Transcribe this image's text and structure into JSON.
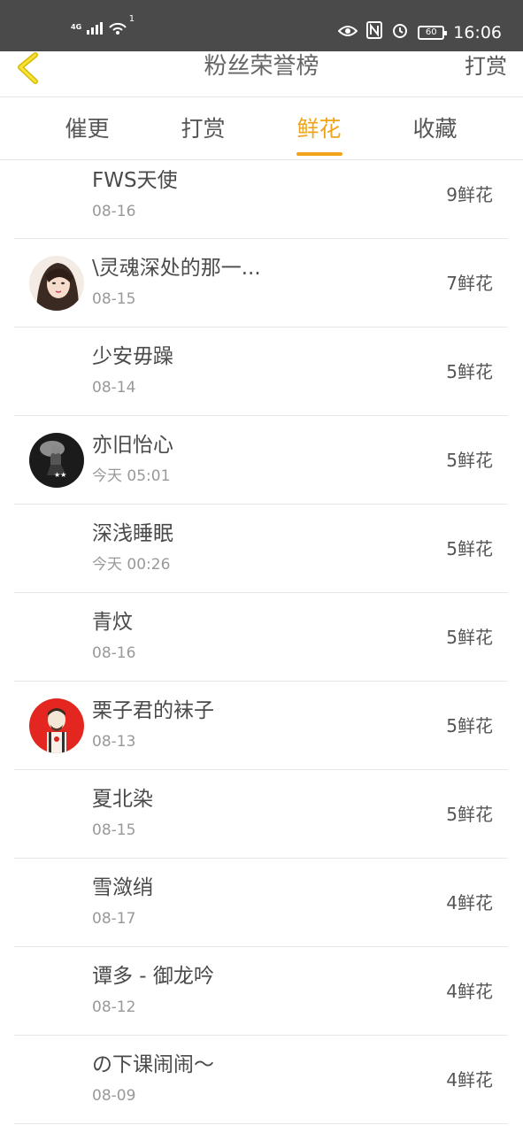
{
  "status_bar": {
    "network": "4G",
    "wifi_badge": "1",
    "battery": "60",
    "time": "16:06",
    "icons": [
      "eye-icon",
      "nfc-icon",
      "alarm-icon"
    ]
  },
  "header": {
    "title": "粉丝荣誉榜",
    "right_action": "打赏",
    "back_icon": "chevron-left-icon",
    "accent_color": "#f0a41c"
  },
  "tabs": [
    {
      "label": "催更"
    },
    {
      "label": "打赏"
    },
    {
      "label": "鲜花"
    },
    {
      "label": "收藏"
    }
  ],
  "active_tab": "鲜花",
  "list": [
    {
      "name": "FWS天使",
      "date": "08-16",
      "count": "9鲜花",
      "avatar": ""
    },
    {
      "name": "\\灵魂深处的那一...",
      "date": "08-15",
      "count": "7鲜花",
      "avatar": "girl-photo-avatar"
    },
    {
      "name": "少安毋躁",
      "date": "08-14",
      "count": "5鲜花",
      "avatar": ""
    },
    {
      "name": "亦旧怡心",
      "date": "今天 05:01",
      "count": "5鲜花",
      "avatar": "dark-photo-avatar"
    },
    {
      "name": "深浅睡眠",
      "date": "今天 00:26",
      "count": "5鲜花",
      "avatar": ""
    },
    {
      "name": "青炆",
      "date": "08-16",
      "count": "5鲜花",
      "avatar": ""
    },
    {
      "name": "栗子君的袜子",
      "date": "08-13",
      "count": "5鲜花",
      "avatar": "red-cartoon-avatar"
    },
    {
      "name": "夏北染",
      "date": "08-15",
      "count": "5鲜花",
      "avatar": ""
    },
    {
      "name": "雪潋绡",
      "date": "08-17",
      "count": "4鲜花",
      "avatar": ""
    },
    {
      "name": "谭多 - 御龙吟",
      "date": "08-12",
      "count": "4鲜花",
      "avatar": ""
    },
    {
      "name": "の下课闹闹～",
      "date": "08-09",
      "count": "4鲜花",
      "avatar": ""
    }
  ]
}
